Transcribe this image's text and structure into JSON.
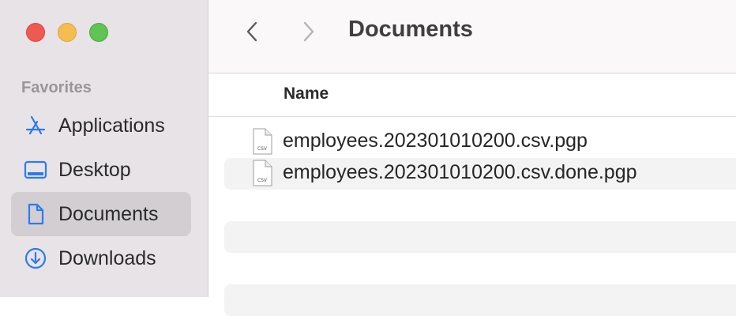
{
  "window": {
    "title": "Documents"
  },
  "sidebar": {
    "section_title": "Favorites",
    "items": [
      {
        "label": "Applications",
        "icon": "applications-icon",
        "selected": false
      },
      {
        "label": "Desktop",
        "icon": "desktop-icon",
        "selected": false
      },
      {
        "label": "Documents",
        "icon": "document-icon",
        "selected": true
      },
      {
        "label": "Downloads",
        "icon": "downloads-icon",
        "selected": false
      }
    ]
  },
  "list": {
    "column_header": "Name",
    "files": [
      {
        "name": "employees.202301010200.csv.pgp",
        "icon_label": "CSV"
      },
      {
        "name": "employees.202301010200.csv.done.pgp",
        "icon_label": "CSV"
      }
    ]
  },
  "colors": {
    "accent": "#2b7bf0",
    "sidebar_bg": "#e8e3e6",
    "selected_bg": "#d3ced1",
    "close": "#ee5a52",
    "minimize": "#f5bd4f",
    "zoom": "#5fc454"
  }
}
